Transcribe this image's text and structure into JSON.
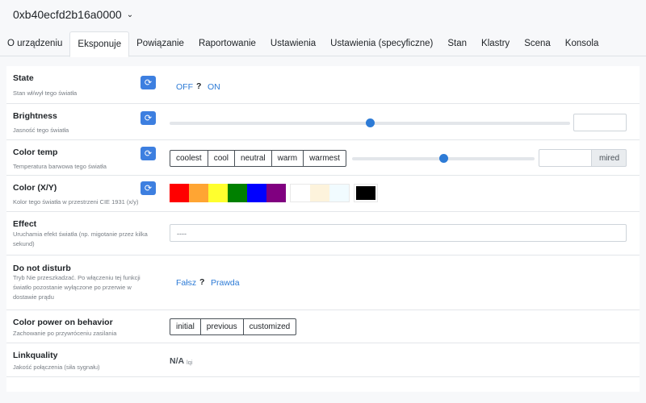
{
  "header": {
    "device_name": "0xb40ecfd2b16a0000"
  },
  "tabs": [
    {
      "label": "O urządzeniu"
    },
    {
      "label": "Eksponuje"
    },
    {
      "label": "Powiązanie"
    },
    {
      "label": "Raportowanie"
    },
    {
      "label": "Ustawienia"
    },
    {
      "label": "Ustawienia (specyficzne)"
    },
    {
      "label": "Stan"
    },
    {
      "label": "Klastry"
    },
    {
      "label": "Scena"
    },
    {
      "label": "Konsola"
    }
  ],
  "active_tab": "Eksponuje",
  "icons": {
    "refresh": "refresh-icon",
    "dropdown": "chevron-down-icon"
  },
  "colors": {
    "accent": "#3d7fe0",
    "link": "#2d7bd6"
  },
  "rows": {
    "state": {
      "label": "State",
      "description": "Stan wł/wył tego światła",
      "off_label": "OFF",
      "unknown_label": "?",
      "on_label": "ON"
    },
    "brightness": {
      "label": "Brightness",
      "description": "Jasność tego światła",
      "value_fraction": 0.5,
      "input_value": ""
    },
    "color_temp": {
      "label": "Color temp",
      "description": "Temperatura barwowa tego światła",
      "presets": [
        "coolest",
        "cool",
        "neutral",
        "warm",
        "warmest"
      ],
      "value_fraction": 0.5,
      "input_value": "",
      "unit": "mired"
    },
    "color_xy": {
      "label": "Color (X/Y)",
      "description": "Kolor tego światła w przestrzeni CIE 1931 (x/y)",
      "swatches_primary": [
        "#ff0000",
        "#ffa533",
        "#ffff2e",
        "#008000",
        "#0000ff",
        "#800080"
      ],
      "swatches_whites": [
        "#ffffff",
        "#fdf3dc",
        "#f1fbff"
      ],
      "swatch_black": "#000000"
    },
    "effect": {
      "label": "Effect",
      "description": "Uruchamia efekt światła (np. migotanie przez kilka sekund)",
      "select_value": "----"
    },
    "do_not_disturb": {
      "label": "Do not disturb",
      "description": "Tryb Nie przeszkadzać. Po włączeniu tej funkcji światło pozostanie wyłączone po przerwie w dostawie prądu",
      "false_label": "Fałsz",
      "unknown_label": "?",
      "true_label": "Prawda"
    },
    "color_power_on_behavior": {
      "label": "Color power on behavior",
      "description": "Zachowanie po przywróceniu zasilania",
      "options": [
        "initial",
        "previous",
        "customized"
      ]
    },
    "linkquality": {
      "label": "Linkquality",
      "description": "Jakość połączenia (siła sygnału)",
      "value": "N/A",
      "unit": "lqi"
    }
  }
}
